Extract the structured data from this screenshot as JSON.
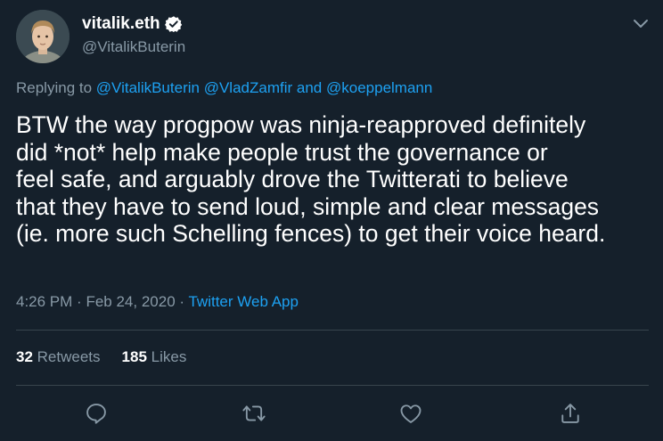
{
  "author": {
    "display_name": "vitalik.eth",
    "handle": "@VitalikButerin",
    "verified": true,
    "avatar": "avatar-photo"
  },
  "replying": {
    "prefix": "Replying to",
    "mention1": "@VitalikButerin",
    "mention2": "@VladZamfir",
    "joiner": "and",
    "mention3": "@koeppelmann"
  },
  "body": {
    "lines": [
      "BTW the way progpow was ninja-reapproved definitely",
      "did *not* help make people trust the governance or",
      "feel safe, and arguably drove the Twitterati to believe",
      "that they have to send loud, simple and clear messages",
      "(ie. more such Schelling fences) to get their voice heard."
    ]
  },
  "meta": {
    "time": "4:26 PM",
    "separator": "·",
    "date": "Feb 24, 2020",
    "source": "Twitter Web App"
  },
  "stats": {
    "retweets_count": "32",
    "retweets_label": "Retweets",
    "likes_count": "185",
    "likes_label": "Likes"
  },
  "actions": [
    "reply-icon",
    "retweet-icon",
    "like-icon",
    "share-icon"
  ],
  "colors": {
    "background": "#15202b",
    "text": "#ffffff",
    "secondary": "#8899a6",
    "accent": "#1da1f2",
    "divider": "#38444d"
  }
}
